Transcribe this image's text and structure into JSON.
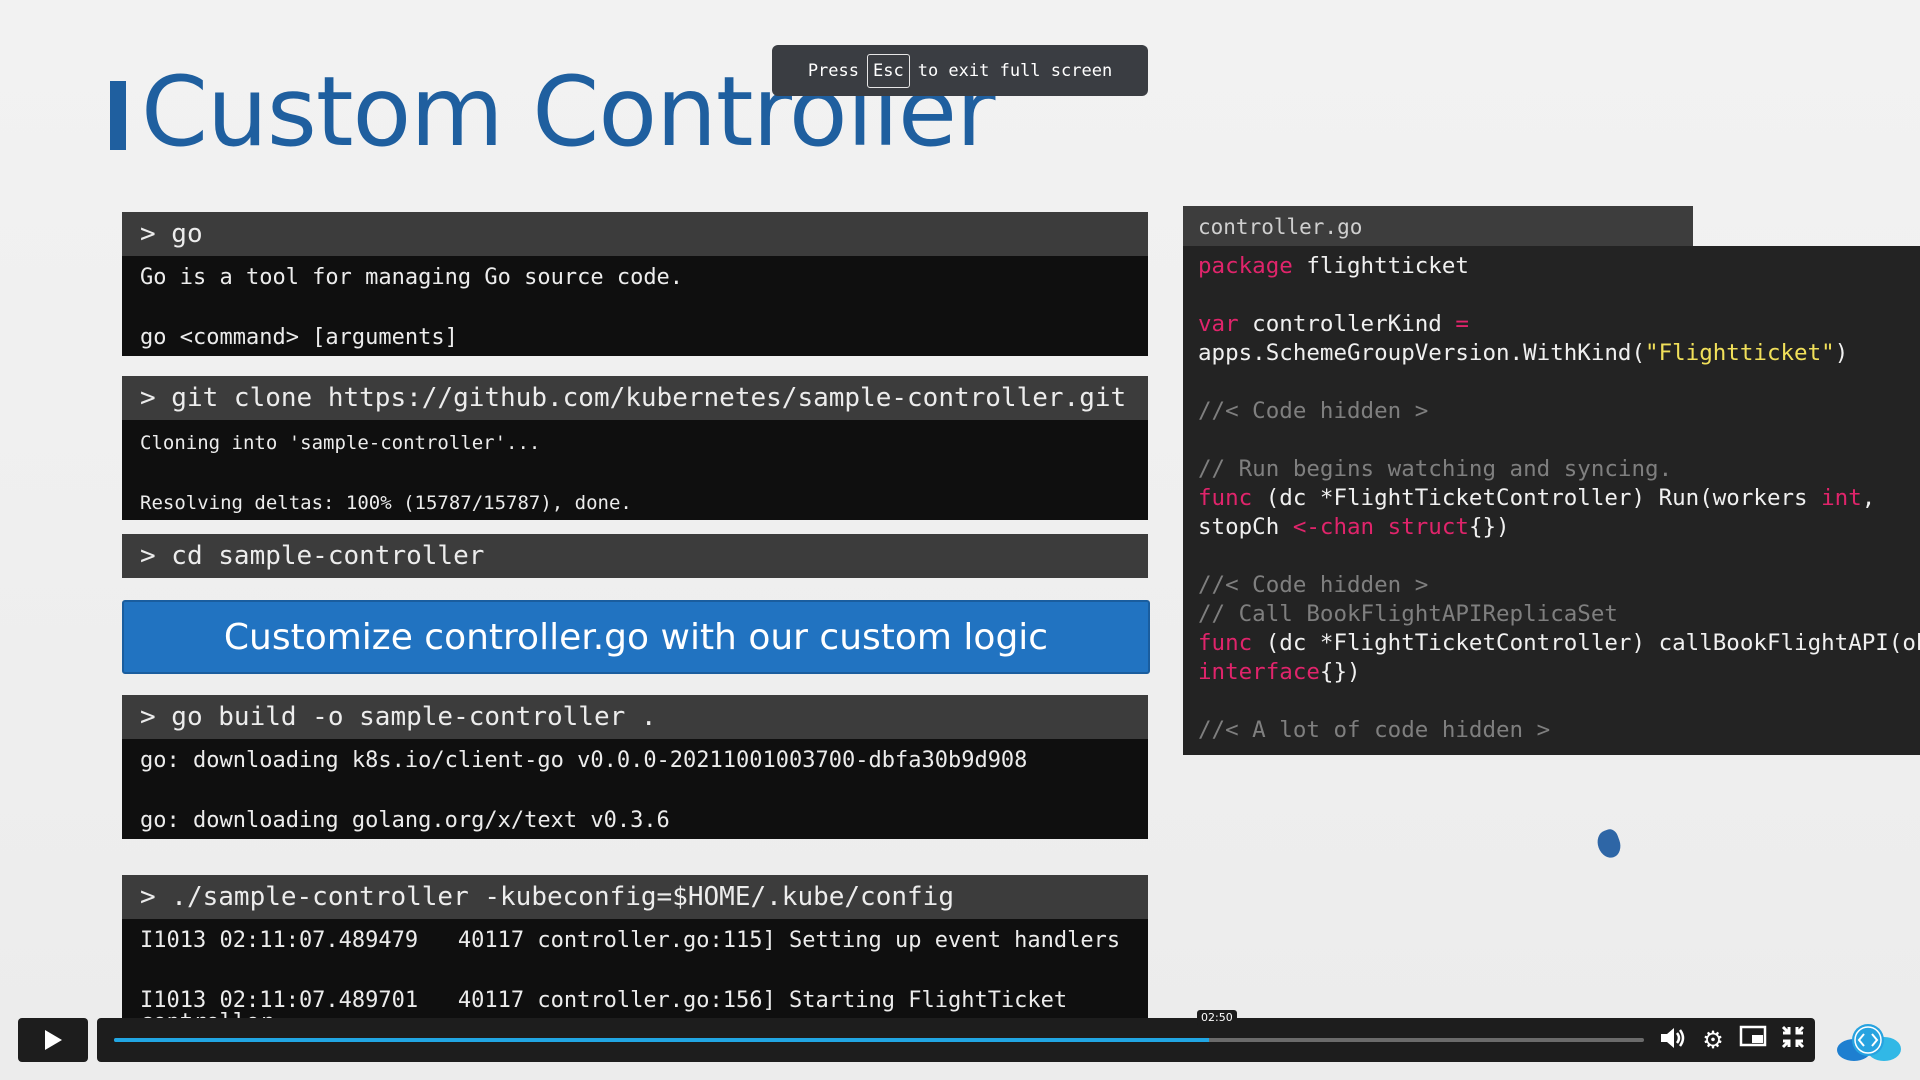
{
  "slide": {
    "title": "Custom Controller"
  },
  "fullscreen_notice": {
    "prefix": "Press",
    "key": "Esc",
    "suffix": "to exit full screen"
  },
  "terminals": [
    {
      "command": "> go",
      "output": [
        "Go is a tool for managing Go source code.",
        "",
        "go <command> [arguments]"
      ]
    },
    {
      "command": "> git clone https://github.com/kubernetes/sample-controller.git",
      "output": [
        "Cloning into 'sample-controller'...",
        "",
        "Resolving deltas: 100% (15787/15787), done."
      ]
    },
    {
      "command": "> cd sample-controller",
      "output": []
    },
    {
      "command": "> go build -o sample-controller .",
      "output": [
        "go: downloading k8s.io/client-go v0.0.0-20211001003700-dbfa30b9d908",
        "",
        "go: downloading golang.org/x/text v0.3.6"
      ]
    },
    {
      "command": "> ./sample-controller -kubeconfig=$HOME/.kube/config",
      "output": [
        "I1013 02:11:07.489479   40117 controller.go:115] Setting up event handlers",
        "",
        "I1013 02:11:07.489701   40117 controller.go:156] Starting FlightTicket",
        "controller"
      ]
    }
  ],
  "callout": "Customize controller.go with our custom logic",
  "code": {
    "filename": "controller.go",
    "l1_kw": "package",
    "l1_rest": " flightticket",
    "l2_kw": "var",
    "l2_mid": " controllerKind ",
    "l2_eq": "=",
    "l3_pre": "apps.SchemeGroupVersion.WithKind(",
    "l3_str": "\"Flightticket\"",
    "l3_post": ")",
    "c1": "//< Code hidden >",
    "c2": "// Run begins watching and syncing.",
    "l4_kw": "func",
    "l4_mid": " (dc *FlightTicketController) Run(workers ",
    "l4_kw2": "int",
    "l4_post": ",",
    "l5_pre": "stopCh ",
    "l5_kw": "<-chan struct",
    "l5_post": "{})",
    "c3": "//< Code hidden >",
    "c4": "// Call BookFlightAPIReplicaSet",
    "l6_kw": "func",
    "l6_rest": " (dc *FlightTicketController) callBookFlightAPI(obj",
    "l7_kw": "interface",
    "l7_post": "{})",
    "c5": "//< A lot of code hidden >"
  },
  "player": {
    "current_time": "02:50",
    "progress_fraction": 0.716,
    "icons": [
      "play-icon",
      "volume-icon",
      "settings-gear-icon",
      "picture-in-picture-icon",
      "exit-fullscreen-icon",
      "code-cloud-icon"
    ],
    "accent": "#21a6e3"
  }
}
